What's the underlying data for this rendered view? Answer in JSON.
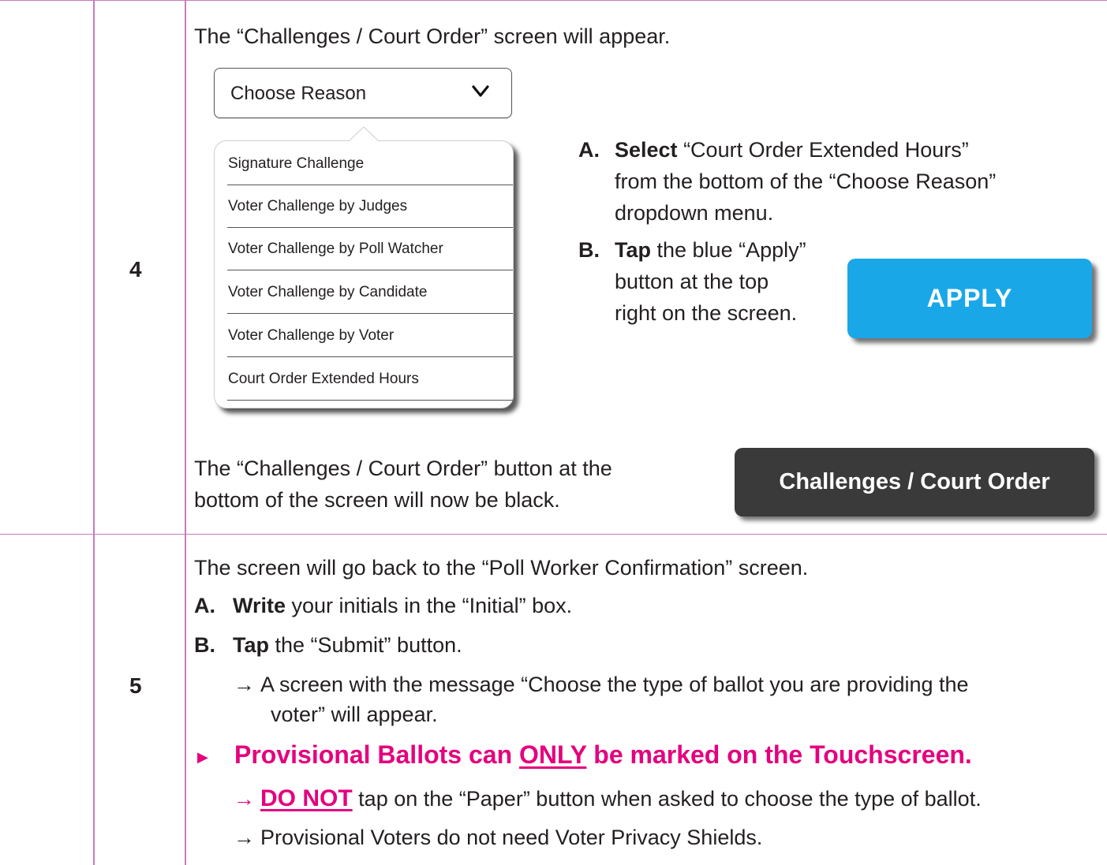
{
  "rows": {
    "row4": {
      "number": "4"
    },
    "row5": {
      "number": "5"
    }
  },
  "step4": {
    "intro": "The “Challenges / Court Order” screen will appear.",
    "dropdown": {
      "selected": "Choose Reason",
      "options": [
        "Signature Challenge",
        "Voter Challenge by Judges",
        "Voter Challenge by Poll Watcher",
        "Voter Challenge by Candidate",
        "Voter Challenge by Voter",
        "Court Order Extended Hours"
      ]
    },
    "instr_a": {
      "letter": "A.",
      "verb": "Select",
      "line1_rest": " “Court Order Extended Hours”",
      "line2": "from the bottom of the “Choose Reason”",
      "line3": "dropdown menu."
    },
    "instr_b": {
      "letter": "B.",
      "verb": "Tap",
      "line1_rest": " the blue “Apply”",
      "line2": "button at the top",
      "line3": "right on the screen."
    },
    "apply_label": "APPLY",
    "note_line1": "The “Challenges / Court Order” button at the",
    "note_line2": "bottom of the screen will now be black.",
    "challenges_label": "Challenges / Court Order"
  },
  "step5": {
    "intro": "The screen will go back to the “Poll Worker Confirmation” screen.",
    "a": {
      "letter": "A.",
      "verb": "Write",
      "rest": " your initials in the “Initial” box."
    },
    "b": {
      "letter": "B.",
      "verb": "Tap",
      "rest": " the “Submit” button."
    },
    "arrow1_line1": "A screen with the message “Choose the type of ballot you are providing the",
    "arrow1_line2": "voter” will appear.",
    "warning": {
      "pre": "Provisional Ballots can ",
      "emph": "ONLY",
      "post": " be marked on the Touchscreen."
    },
    "arrow2": {
      "emph": "DO NOT",
      "rest": " tap on the “Paper” button when asked to choose the type of ballot."
    },
    "arrow3": "Provisional Voters do not need Voter Privacy Shields."
  },
  "colors": {
    "magenta": "#e5007d",
    "rule": "#c77ac0",
    "apply_blue": "#1aa7e8",
    "dark_button": "#3a3a3a"
  }
}
